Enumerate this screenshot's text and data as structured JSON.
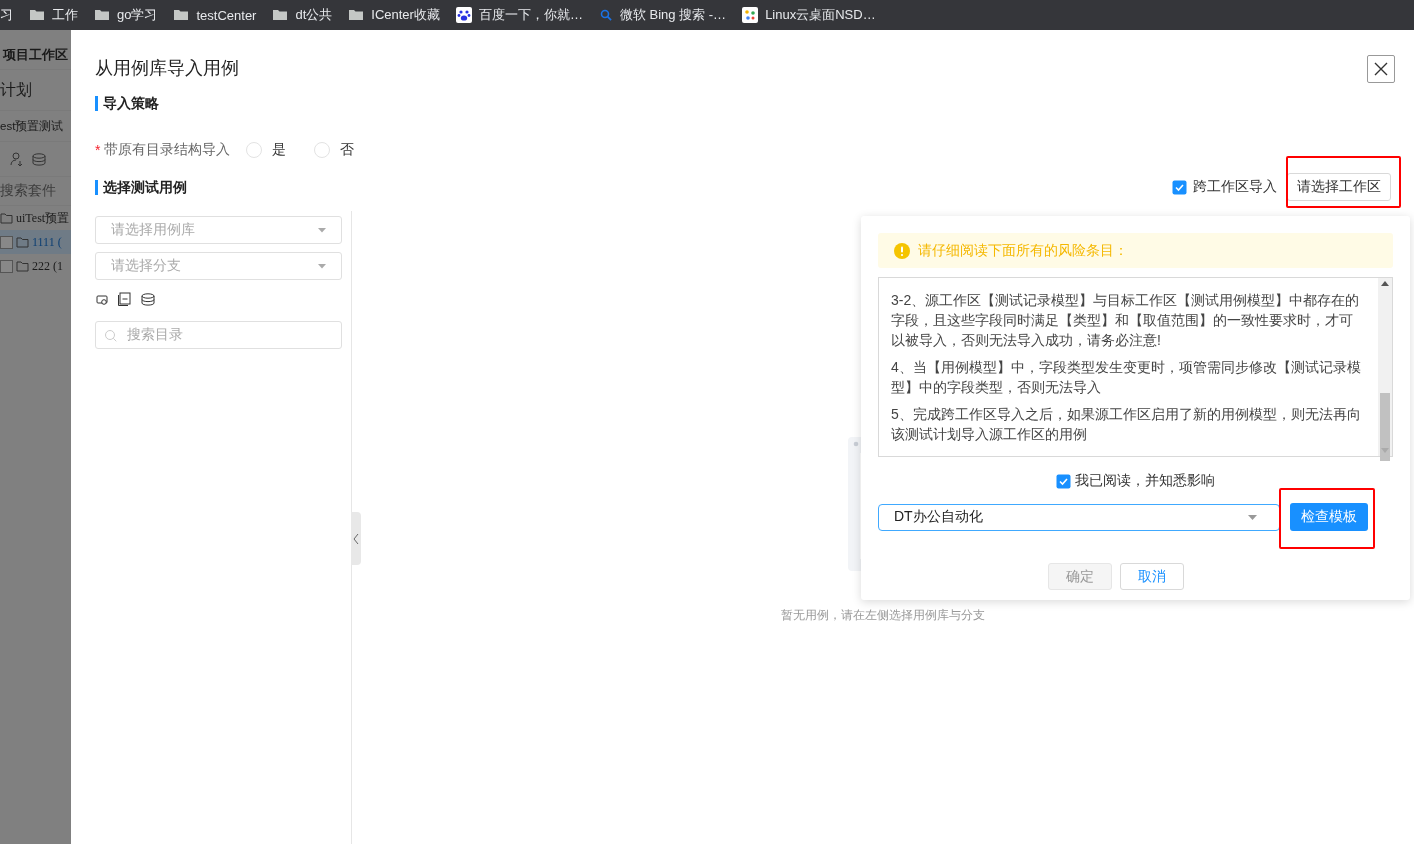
{
  "bookmarks": [
    {
      "label": "习",
      "kind": "text"
    },
    {
      "label": "工作",
      "kind": "folder"
    },
    {
      "label": "go学习",
      "kind": "folder"
    },
    {
      "label": "testCenter",
      "kind": "folder"
    },
    {
      "label": "dt公共",
      "kind": "folder"
    },
    {
      "label": "ICenter收藏",
      "kind": "folder"
    },
    {
      "label": "百度一下，你就…",
      "kind": "paw"
    },
    {
      "label": "微软 Bing 搜索 -…",
      "kind": "search"
    },
    {
      "label": "Linux云桌面NSD…",
      "kind": "app"
    }
  ],
  "background_app": {
    "title": "项目工作区",
    "menu_item": "计划",
    "plan_name": "est预置测试",
    "search_placeholder": "搜索套件",
    "tree": [
      {
        "label": "uiTest预置",
        "children": [
          {
            "label": "1111 (",
            "selected": true
          },
          {
            "label": "222 (1",
            "selected": false
          }
        ]
      }
    ]
  },
  "drawer": {
    "title": "从用例库导入用例",
    "strategy": {
      "heading": "导入策略",
      "label": "带原有目录结构导入",
      "required_mark": "*",
      "options": [
        {
          "label": "是",
          "selected": false
        },
        {
          "label": "否",
          "selected": false
        }
      ]
    },
    "cases": {
      "heading": "选择测试用例",
      "library_select": {
        "placeholder": "请选择用例库"
      },
      "branch_select": {
        "placeholder": "请选择分支"
      },
      "search": {
        "placeholder": "搜索目录"
      },
      "empty_text": "暂无用例，请在左侧选择用例库与分支"
    },
    "cross_workspace": {
      "label": "跨工作区导入",
      "checked": true
    },
    "workspace_button": {
      "label": "请选择工作区",
      "highlighted": true
    }
  },
  "risk_popover": {
    "alert": "请仔细阅读下面所有的风险条目：",
    "items": [
      "3-2、源工作区【测试记录模型】与目标工作区【测试用例模型】中都存在的字段，且这些字段同时满足【类型】和【取值范围】的一致性要求时，才可以被导入，否则无法导入成功，请务必注意!",
      "4、当【用例模型】中，字段类型发生变更时，项管需同步修改【测试记录模型】中的字段类型，否则无法导入",
      "5、完成跨工作区导入之后，如果源工作区启用了新的用例模型，则无法再向该测试计划导入源工作区的用例"
    ],
    "acknowledge": {
      "label": "我已阅读，并知悉影响",
      "checked": true
    },
    "workspace_select": {
      "value": "DT办公自动化"
    },
    "check_button": {
      "label": "检查模板",
      "highlighted": true
    },
    "buttons": [
      {
        "label": "确定",
        "disabled": true
      },
      {
        "label": "取消",
        "disabled": false
      }
    ]
  }
}
